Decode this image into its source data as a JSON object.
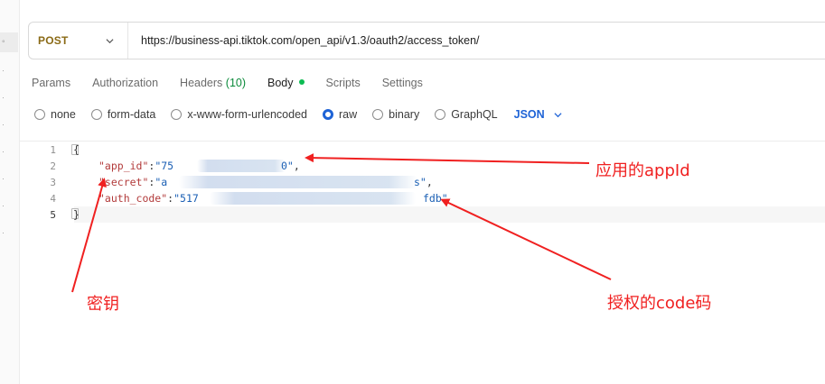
{
  "request": {
    "method": "POST",
    "url": "https://business-api.tiktok.com/open_api/v1.3/oauth2/access_token/"
  },
  "tabs": [
    {
      "label": "Params"
    },
    {
      "label": "Authorization"
    },
    {
      "label": "Headers",
      "count": "(10)"
    },
    {
      "label": "Body",
      "active": true
    },
    {
      "label": "Scripts"
    },
    {
      "label": "Settings"
    }
  ],
  "body_modes": [
    {
      "label": "none",
      "selected": false
    },
    {
      "label": "form-data",
      "selected": false
    },
    {
      "label": "x-www-form-urlencoded",
      "selected": false
    },
    {
      "label": "raw",
      "selected": true
    },
    {
      "label": "binary",
      "selected": false
    },
    {
      "label": "GraphQL",
      "selected": false
    }
  ],
  "format": "JSON",
  "editor": {
    "line_numbers": [
      "1",
      "2",
      "3",
      "4",
      "5"
    ],
    "open_brace": "{",
    "close_brace": "}",
    "lines": [
      {
        "key": "\"app_id\"",
        "value_start": "\"75",
        "value_end": "0\"",
        "trail": ","
      },
      {
        "key": "\"secret\"",
        "value_start": "\"a",
        "value_end": "s\"",
        "trail": ","
      },
      {
        "key": "\"auth_code\"",
        "value_start": "\"517",
        "value_end": "fdb\"",
        "trail": ""
      }
    ]
  },
  "annotations": {
    "app_id": "应用的appId",
    "secret": "密钥",
    "auth_code": "授权的code码"
  },
  "colors": {
    "accent": "#1e63d6",
    "method": "#8a6a16",
    "annotation": "#f02020",
    "body_dot": "#0cbb52"
  }
}
